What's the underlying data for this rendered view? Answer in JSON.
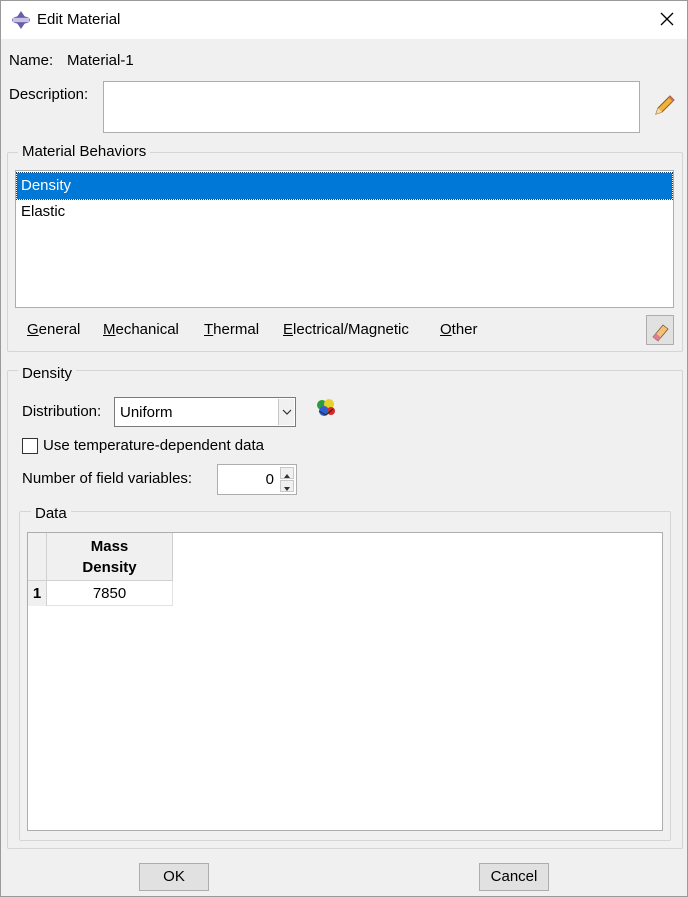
{
  "window": {
    "title": "Edit Material"
  },
  "name": {
    "label": "Name:",
    "value": "Material-1"
  },
  "description": {
    "label": "Description:",
    "value": ""
  },
  "behaviors": {
    "group_title": "Material Behaviors",
    "items": [
      {
        "label": "Density",
        "selected": true
      },
      {
        "label": "Elastic",
        "selected": false
      }
    ]
  },
  "menu": {
    "items": [
      {
        "first": "G",
        "rest": "eneral"
      },
      {
        "first": "M",
        "rest": "echanical"
      },
      {
        "first": "T",
        "rest": "hermal"
      },
      {
        "first": "E",
        "rest": "lectrical/Magnetic"
      },
      {
        "first": "O",
        "rest": "ther"
      }
    ]
  },
  "density": {
    "group_title": "Density",
    "distribution_label": "Distribution:",
    "distribution_value": "Uniform",
    "temp_dependent_label": "Use temperature-dependent data",
    "temp_dependent_checked": false,
    "field_vars_label": "Number of field variables:",
    "field_vars_value": "0"
  },
  "data_table": {
    "group_title": "Data",
    "header_line1": "Mass",
    "header_line2": "Density",
    "rows": [
      {
        "num": "1",
        "value": "7850"
      }
    ]
  },
  "buttons": {
    "ok": "OK",
    "cancel": "Cancel"
  },
  "colors": {
    "selection": "#0078d7",
    "background": "#f0f0f0"
  }
}
